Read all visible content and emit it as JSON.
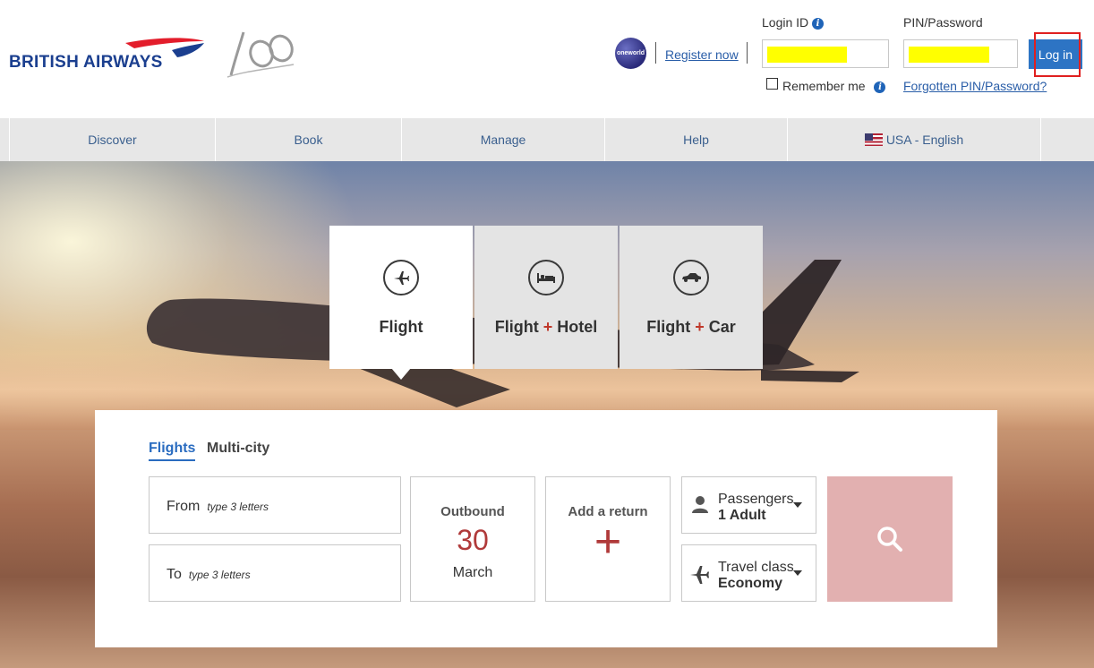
{
  "brand": {
    "name": "BRITISH AIRWAYS",
    "centenary": "100"
  },
  "header": {
    "oneworld_label": "oneworld",
    "register_link": "Register now",
    "login_id_label": "Login ID",
    "pin_label": "PIN/Password",
    "login_button": "Log in",
    "remember_label": "Remember me",
    "forgot_link": "Forgotten PIN/Password?",
    "info_glyph": "i"
  },
  "nav": {
    "items": [
      "Discover",
      "Book",
      "Manage",
      "Help"
    ],
    "locale": "USA - English"
  },
  "product_tabs": [
    {
      "label_a": "Flight",
      "plus": "",
      "label_b": "",
      "icon": "plane-icon"
    },
    {
      "label_a": "Flight ",
      "plus": "+",
      "label_b": " Hotel",
      "icon": "bed-icon"
    },
    {
      "label_a": "Flight ",
      "plus": "+",
      "label_b": " Car",
      "icon": "car-icon"
    }
  ],
  "search": {
    "tabs": [
      "Flights",
      "Multi-city"
    ],
    "from_label": "From",
    "from_hint": "type 3 letters",
    "to_label": "To",
    "to_hint": "type 3 letters",
    "outbound_label": "Outbound",
    "outbound_day": "30",
    "outbound_month": "March",
    "return_label": "Add a return",
    "return_plus": "+",
    "passengers_label": "Passengers",
    "passengers_value": "1 Adult",
    "class_label": "Travel class",
    "class_value": "Economy"
  },
  "colors": {
    "brand_blue": "#1b3f8f",
    "login_blue": "#2d74c4",
    "accent_red": "#b03a3a",
    "search_button": "#e2b0b0",
    "highlight_yellow": "#ffff00"
  }
}
